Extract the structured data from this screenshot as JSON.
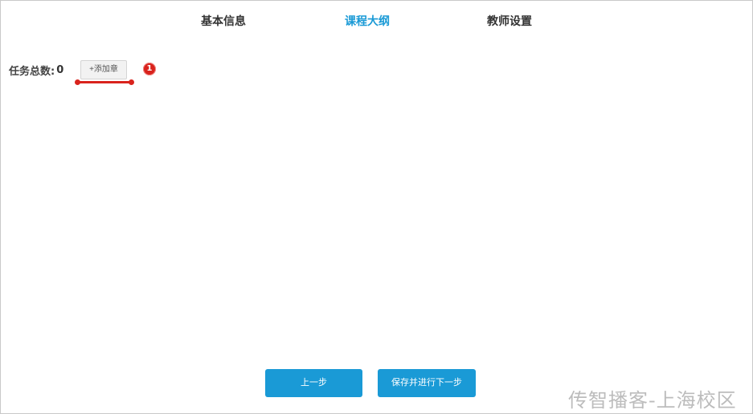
{
  "tabs": [
    {
      "label": "基本信息",
      "active": false
    },
    {
      "label": "课程大纲",
      "active": true
    },
    {
      "label": "教师设置",
      "active": false
    }
  ],
  "task": {
    "label": "任务总数:",
    "count": "0",
    "add_chapter_label": "+添加章"
  },
  "annotation": {
    "badge_number": "1"
  },
  "footer": {
    "prev_label": "上一步",
    "next_label": "保存并进行下一步"
  },
  "watermark": {
    "text": "传智播客-上海校区"
  },
  "colors": {
    "accent": "#1a9ad6",
    "annotation_red": "#d9231d",
    "text": "#333333"
  }
}
